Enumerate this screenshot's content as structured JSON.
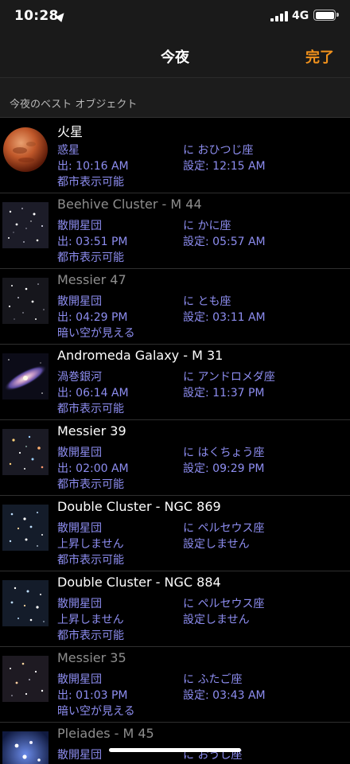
{
  "status_bar": {
    "time": "10:28",
    "network": "4G"
  },
  "nav": {
    "title": "今夜",
    "done_label": "完了"
  },
  "section": {
    "title": "今夜のベスト オブジェクト"
  },
  "objects": [
    {
      "name": "火星",
      "type": "惑星",
      "constellation": "に おひつじ座",
      "rise": "出: 10:16 AM",
      "set": "設定: 12:15 AM",
      "visibility": "都市表示可能",
      "dimmed": false,
      "thumb": "mars-image"
    },
    {
      "name": "Beehive Cluster - M 44",
      "type": "散開星団",
      "constellation": "に かに座",
      "rise": "出: 03:51 PM",
      "set": "設定: 05:57 AM",
      "visibility": "都市表示可能",
      "dimmed": true,
      "thumb": "beehive-cluster-image"
    },
    {
      "name": "Messier 47",
      "type": "散開星団",
      "constellation": "に とも座",
      "rise": "出: 04:29 PM",
      "set": "設定: 03:11 AM",
      "visibility": "暗い空が見える",
      "dimmed": true,
      "thumb": "messier-47-image"
    },
    {
      "name": "Andromeda Galaxy - M 31",
      "type": "渦巻銀河",
      "constellation": "に アンドロメダ座",
      "rise": "出: 06:14 AM",
      "set": "設定: 11:37 PM",
      "visibility": "都市表示可能",
      "dimmed": false,
      "thumb": "andromeda-galaxy-image"
    },
    {
      "name": "Messier 39",
      "type": "散開星団",
      "constellation": "に はくちょう座",
      "rise": "出: 02:00 AM",
      "set": "設定: 09:29 PM",
      "visibility": "都市表示可能",
      "dimmed": false,
      "thumb": "messier-39-image"
    },
    {
      "name": "Double Cluster - NGC 869",
      "type": "散開星団",
      "constellation": "に ペルセウス座",
      "rise": "上昇しません",
      "set": "設定しません",
      "visibility": "都市表示可能",
      "dimmed": false,
      "thumb": "ngc-869-image"
    },
    {
      "name": "Double Cluster - NGC 884",
      "type": "散開星団",
      "constellation": "に ペルセウス座",
      "rise": "上昇しません",
      "set": "設定しません",
      "visibility": "都市表示可能",
      "dimmed": false,
      "thumb": "ngc-884-image"
    },
    {
      "name": "Messier 35",
      "type": "散開星団",
      "constellation": "に ふたご座",
      "rise": "出: 01:03 PM",
      "set": "設定: 03:43 AM",
      "visibility": "暗い空が見える",
      "dimmed": true,
      "thumb": "messier-35-image"
    },
    {
      "name": "Pleiades - M 45",
      "type": "散開星団",
      "constellation": "に おうし座",
      "rise": "",
      "set": "",
      "visibility": "",
      "dimmed": true,
      "thumb": "pleiades-image"
    }
  ],
  "colors": {
    "accent": "#f2921c",
    "info_text": "#8d8df0",
    "background": "#000000",
    "bar": "#1a1a1a"
  }
}
